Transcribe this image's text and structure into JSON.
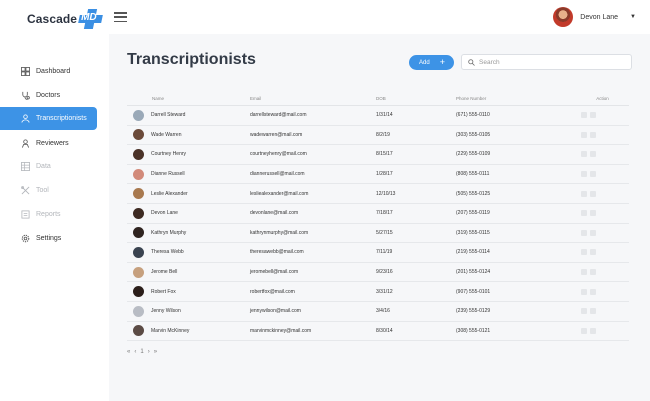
{
  "header": {
    "logo_text": "Cascade",
    "logo_badge": "MD",
    "user_name": "Devon Lane"
  },
  "sidebar": {
    "items": [
      {
        "label": "Dashboard",
        "icon": "dashboard-icon",
        "state": "normal"
      },
      {
        "label": "Doctors",
        "icon": "stethoscope-icon",
        "state": "normal"
      },
      {
        "label": "Transcriptionists",
        "icon": "person-icon",
        "state": "active"
      },
      {
        "label": "Reviewers",
        "icon": "reviewer-icon",
        "state": "normal"
      },
      {
        "label": "Data",
        "icon": "table-icon",
        "state": "disabled"
      },
      {
        "label": "Tool",
        "icon": "tool-icon",
        "state": "disabled"
      },
      {
        "label": "Reports",
        "icon": "reports-icon",
        "state": "disabled"
      },
      {
        "label": "Settings",
        "icon": "gear-icon",
        "state": "normal"
      }
    ]
  },
  "main": {
    "title": "Transcriptionists",
    "add_label": "Add",
    "search_placeholder": "Search",
    "columns": {
      "name": "Name",
      "email": "Email",
      "dob": "DOB",
      "phone": "Phone Number",
      "action": "Action"
    },
    "rows": [
      {
        "name": "Darrell Steward",
        "email": "darrellsteward@mail.com",
        "dob": "1/31/14",
        "phone": "(671) 555-0110",
        "avatar_color": "#9aa9b8"
      },
      {
        "name": "Wade Warren",
        "email": "wadewarren@mail.com",
        "dob": "8/2/19",
        "phone": "(303) 555-0105",
        "avatar_color": "#6b4a3a"
      },
      {
        "name": "Courtney Henry",
        "email": "courtneyhenry@mail.com",
        "dob": "8/15/17",
        "phone": "(229) 555-0109",
        "avatar_color": "#4a3228"
      },
      {
        "name": "Dianne Russell",
        "email": "diannerussell@mail.com",
        "dob": "1/28/17",
        "phone": "(808) 555-0111",
        "avatar_color": "#d28a7a"
      },
      {
        "name": "Leslie Alexander",
        "email": "lesliealexander@mail.com",
        "dob": "12/10/13",
        "phone": "(505) 555-0125",
        "avatar_color": "#a8794f"
      },
      {
        "name": "Devon Lane",
        "email": "devonlane@mail.com",
        "dob": "7/18/17",
        "phone": "(207) 555-0119",
        "avatar_color": "#3d2a22"
      },
      {
        "name": "Kathryn Murphy",
        "email": "kathrynmurphy@mail.com",
        "dob": "5/27/15",
        "phone": "(319) 555-0115",
        "avatar_color": "#2f2420"
      },
      {
        "name": "Theresa Webb",
        "email": "theresawebb@mail.com",
        "dob": "7/11/19",
        "phone": "(219) 555-0114",
        "avatar_color": "#3a4350"
      },
      {
        "name": "Jerome Bell",
        "email": "jeromebell@mail.com",
        "dob": "9/23/16",
        "phone": "(201) 555-0124",
        "avatar_color": "#c6a07e"
      },
      {
        "name": "Robert Fox",
        "email": "robertfox@mail.com",
        "dob": "3/31/12",
        "phone": "(907) 555-0101",
        "avatar_color": "#2b1e1a"
      },
      {
        "name": "Jenny Wilson",
        "email": "jennywilson@mail.com",
        "dob": "3/4/16",
        "phone": "(239) 555-0129",
        "avatar_color": "#b8bcc4"
      },
      {
        "name": "Marvin McKinney",
        "email": "marvinmckinney@mail.com",
        "dob": "8/30/14",
        "phone": "(308) 555-0121",
        "avatar_color": "#5b4b45"
      }
    ],
    "pagination": {
      "first": "«",
      "prev": "‹",
      "current": "1",
      "next": "›",
      "last": "»"
    }
  },
  "colors": {
    "accent": "#3d93e6",
    "background": "#f6f7f9"
  }
}
